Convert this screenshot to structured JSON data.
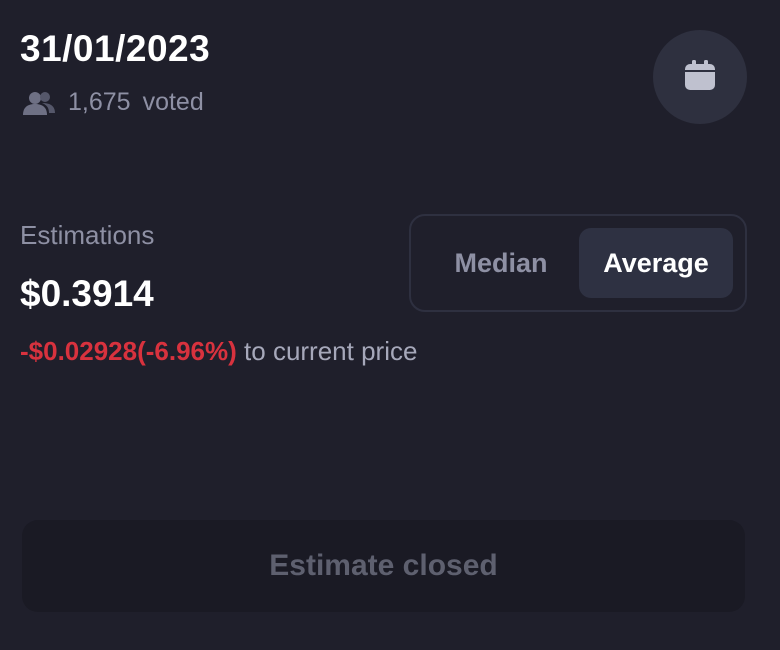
{
  "header": {
    "date": "31/01/2023",
    "voters_count": "1,675",
    "voters_label": "voted",
    "voters_icon": "users-icon",
    "calendar_icon": "calendar-icon"
  },
  "estimations": {
    "label": "Estimations",
    "value": "$0.3914",
    "change": "-$0.02928(-6.96%)",
    "change_suffix": " to current price",
    "change_color": "#d8323e"
  },
  "toggle": {
    "options": [
      "Median",
      "Average"
    ],
    "selected": "Average"
  },
  "action": {
    "button_label": "Estimate closed",
    "disabled": true
  },
  "colors": {
    "background": "#1f1f2b",
    "muted_text": "#8e90a4",
    "negative": "#d8323e"
  }
}
